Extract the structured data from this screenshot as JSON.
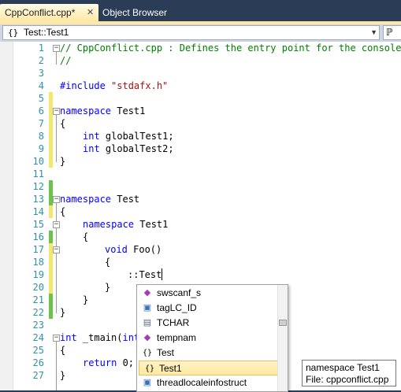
{
  "tabs": {
    "active_label": "CppConflict.cpp*",
    "active_close": "✕",
    "inactive_label": "Object Browser"
  },
  "navbar": {
    "scope_icon": "{}",
    "scope_value": "Test::Test1",
    "scope_dropdown": "▼",
    "member_icon": "ℙ"
  },
  "line_numbers": [
    "1",
    "2",
    "3",
    "4",
    "5",
    "6",
    "7",
    "8",
    "9",
    "10",
    "11",
    "12",
    "13",
    "14",
    "15",
    "16",
    "17",
    "18",
    "19",
    "20",
    "21",
    "22",
    "23",
    "24",
    "25",
    "26",
    "27"
  ],
  "code": {
    "l1": "// CppConflict.cpp : Defines the entry point for the console a",
    "l2": "//",
    "l4_directive": "#include",
    "l4_string": "\"stdafx.h\"",
    "l6_kw": "namespace",
    "l6_rest": " Test1",
    "l7": "{",
    "l8_kw": "int",
    "l8_rest": " globalTest1;",
    "l9_kw": "int",
    "l9_rest": " globalTest2;",
    "l10": "}",
    "l13_kw": "namespace",
    "l13_rest": " Test",
    "l14": "{",
    "l15_kw": "namespace",
    "l15_rest": " Test1",
    "l16": "{",
    "l17_kw": "void",
    "l17_rest": " Foo()",
    "l18": "{",
    "l19": "::Test",
    "l20": "}",
    "l21": "}",
    "l22": "}",
    "l24_kw": "int",
    "l24_rest": " _tmain(",
    "l24_kw2": "int",
    "l25": "{",
    "l26_kw": "return",
    "l26_rest": " 0;",
    "l27": "}"
  },
  "completion": {
    "items": [
      {
        "icon": "◆",
        "icon_name": "function-icon",
        "label": "swscanf_s"
      },
      {
        "icon": "▣",
        "icon_name": "macro-icon",
        "label": "tagLC_ID"
      },
      {
        "icon": "▤",
        "icon_name": "typedef-icon",
        "label": "TCHAR"
      },
      {
        "icon": "◆",
        "icon_name": "function-icon",
        "label": "tempnam"
      },
      {
        "icon": "{}",
        "icon_name": "namespace-icon",
        "label": "Test"
      },
      {
        "icon": "{}",
        "icon_name": "namespace-icon",
        "label": "Test1"
      },
      {
        "icon": "▣",
        "icon_name": "struct-icon",
        "label": "threadlocaleinfostruct"
      }
    ],
    "selected_index": 5
  },
  "tooltip": {
    "line1": "namespace Test1",
    "line2": "File: cppconflict.cpp"
  },
  "colors": {
    "keyword": "#0000ff",
    "comment": "#008000",
    "string": "#a31515",
    "line_number": "#2b91af",
    "change_saved": "#6cc24a",
    "change_unsaved": "#f2e86d"
  }
}
